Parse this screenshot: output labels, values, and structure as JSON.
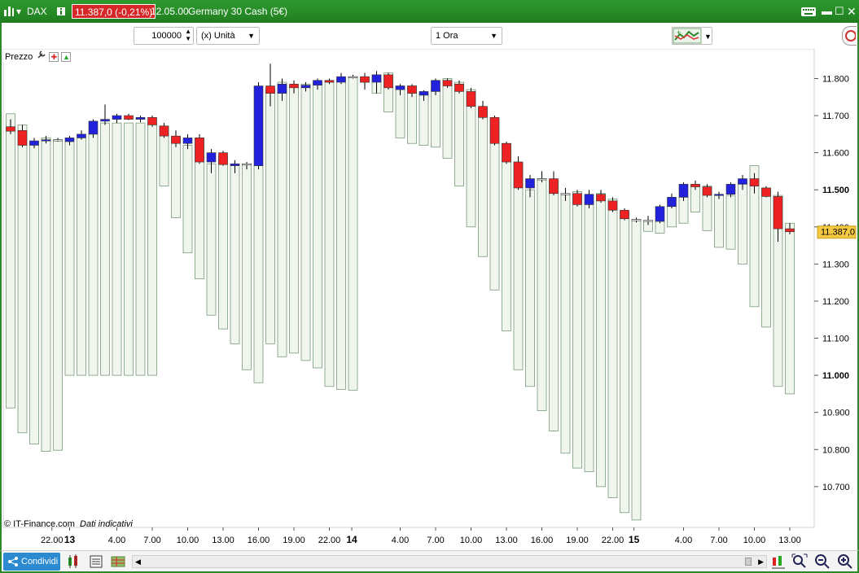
{
  "window": {
    "symbol": "DAX",
    "price_badge": "11.387,0 (-0,21%)",
    "time": "12.05.00",
    "instrument": "Germany 30 Cash (5€)"
  },
  "toolbar": {
    "quantity": "100000",
    "unit_select": "(x) Unità",
    "timeframe_select": "1 Ora"
  },
  "chart_header": {
    "label": "Prezzo"
  },
  "footer": {
    "copyright": "© IT-Finance.com",
    "disclaimer": "Dati indicativi",
    "share_label": "Condividi"
  },
  "colors": {
    "up": "#2222dd",
    "down": "#ee2222",
    "flat": "#ffffff",
    "volume_fill": "#f0f5ee",
    "volume_stroke": "#7a9a7a",
    "current_price": "#f5c842"
  },
  "chart_data": {
    "type": "candlestick",
    "y_ticks": [
      "11.800",
      "11.700",
      "11.600",
      "11.500",
      "11.400",
      "11.300",
      "11.200",
      "11.100",
      "11.000",
      "10.900",
      "10.800",
      "10.700"
    ],
    "y_tick_values": [
      11800,
      11700,
      11600,
      11500,
      11400,
      11300,
      11200,
      11100,
      11000,
      10900,
      10800,
      10700
    ],
    "y_bold_ticks": [
      "11.500",
      "11.000"
    ],
    "ylim": [
      10590,
      11880
    ],
    "current_price_label": "11.387,0",
    "current_price": 11387,
    "x_ticks": [
      {
        "label": "22.00",
        "bold": false,
        "index": 3.5
      },
      {
        "label": "13",
        "bold": true,
        "index": 5
      },
      {
        "label": "4.00",
        "bold": false,
        "index": 9
      },
      {
        "label": "7.00",
        "bold": false,
        "index": 12
      },
      {
        "label": "10.00",
        "bold": false,
        "index": 15
      },
      {
        "label": "13.00",
        "bold": false,
        "index": 18
      },
      {
        "label": "16.00",
        "bold": false,
        "index": 21
      },
      {
        "label": "19.00",
        "bold": false,
        "index": 24
      },
      {
        "label": "22.00",
        "bold": false,
        "index": 27
      },
      {
        "label": "14",
        "bold": true,
        "index": 28.9
      },
      {
        "label": "4.00",
        "bold": false,
        "index": 33
      },
      {
        "label": "7.00",
        "bold": false,
        "index": 36
      },
      {
        "label": "10.00",
        "bold": false,
        "index": 39
      },
      {
        "label": "13.00",
        "bold": false,
        "index": 42
      },
      {
        "label": "16.00",
        "bold": false,
        "index": 45
      },
      {
        "label": "19.00",
        "bold": false,
        "index": 48
      },
      {
        "label": "22.00",
        "bold": false,
        "index": 51
      },
      {
        "label": "15",
        "bold": true,
        "index": 52.8
      },
      {
        "label": "4.00",
        "bold": false,
        "index": 57
      },
      {
        "label": "7.00",
        "bold": false,
        "index": 60
      },
      {
        "label": "10.00",
        "bold": false,
        "index": 63
      },
      {
        "label": "13.00",
        "bold": false,
        "index": 66
      }
    ],
    "candles": [
      {
        "o": 11670,
        "h": 11690,
        "l": 11650,
        "c": 11658,
        "bh": 11705,
        "bl": 10912
      },
      {
        "o": 11660,
        "h": 11675,
        "l": 11615,
        "c": 11620,
        "bh": 11675,
        "bl": 10845
      },
      {
        "o": 11620,
        "h": 11640,
        "l": 11612,
        "c": 11632,
        "bh": 11630,
        "bl": 10815
      },
      {
        "o": 11632,
        "h": 11645,
        "l": 11625,
        "c": 11635,
        "bh": 11640,
        "bl": 10795
      },
      {
        "o": 11635,
        "h": 11640,
        "l": 11630,
        "c": 11635,
        "bh": 11635,
        "bl": 10798
      },
      {
        "o": 11630,
        "h": 11645,
        "l": 11620,
        "c": 11640,
        "bh": 11630,
        "bl": 11000
      },
      {
        "o": 11640,
        "h": 11660,
        "l": 11635,
        "c": 11650,
        "bh": 11640,
        "bl": 11000
      },
      {
        "o": 11650,
        "h": 11690,
        "l": 11640,
        "c": 11685,
        "bh": 11650,
        "bl": 11000
      },
      {
        "o": 11685,
        "h": 11730,
        "l": 11675,
        "c": 11690,
        "bh": 11680,
        "bl": 11000
      },
      {
        "o": 11690,
        "h": 11705,
        "l": 11680,
        "c": 11700,
        "bh": 11680,
        "bl": 11000
      },
      {
        "o": 11700,
        "h": 11705,
        "l": 11688,
        "c": 11690,
        "bh": 11680,
        "bl": 11000
      },
      {
        "o": 11690,
        "h": 11700,
        "l": 11682,
        "c": 11695,
        "bh": 11680,
        "bl": 11000
      },
      {
        "o": 11695,
        "h": 11700,
        "l": 11670,
        "c": 11675,
        "bh": 11680,
        "bl": 11000
      },
      {
        "o": 11672,
        "h": 11680,
        "l": 11640,
        "c": 11645,
        "bh": 11672,
        "bl": 11510
      },
      {
        "o": 11645,
        "h": 11660,
        "l": 11615,
        "c": 11625,
        "bh": 11640,
        "bl": 11425
      },
      {
        "o": 11625,
        "h": 11650,
        "l": 11610,
        "c": 11640,
        "bh": 11620,
        "bl": 11330
      },
      {
        "o": 11640,
        "h": 11650,
        "l": 11570,
        "c": 11575,
        "bh": 11640,
        "bl": 11260
      },
      {
        "o": 11575,
        "h": 11610,
        "l": 11545,
        "c": 11600,
        "bh": 11570,
        "bl": 11162
      },
      {
        "o": 11600,
        "h": 11605,
        "l": 11565,
        "c": 11568,
        "bh": 11590,
        "bl": 11125
      },
      {
        "o": 11565,
        "h": 11580,
        "l": 11545,
        "c": 11570,
        "bh": 11565,
        "bl": 11085
      },
      {
        "o": 11570,
        "h": 11575,
        "l": 11555,
        "c": 11570,
        "bh": 11570,
        "bl": 11015
      },
      {
        "o": 11565,
        "h": 11790,
        "l": 11555,
        "c": 11780,
        "bh": 11565,
        "bl": 10980
      },
      {
        "o": 11780,
        "h": 11840,
        "l": 11725,
        "c": 11760,
        "bh": 11770,
        "bl": 11085
      },
      {
        "o": 11760,
        "h": 11800,
        "l": 11740,
        "c": 11785,
        "bh": 11790,
        "bl": 11050
      },
      {
        "o": 11785,
        "h": 11795,
        "l": 11760,
        "c": 11775,
        "bh": 11780,
        "bl": 11060
      },
      {
        "o": 11775,
        "h": 11790,
        "l": 11765,
        "c": 11782,
        "bh": 11785,
        "bl": 11040
      },
      {
        "o": 11782,
        "h": 11800,
        "l": 11770,
        "c": 11795,
        "bh": 11790,
        "bl": 11020
      },
      {
        "o": 11795,
        "h": 11800,
        "l": 11785,
        "c": 11790,
        "bh": 11790,
        "bl": 10970
      },
      {
        "o": 11790,
        "h": 11815,
        "l": 11785,
        "c": 11805,
        "bh": 11800,
        "bl": 10962
      },
      {
        "o": 11805,
        "h": 11810,
        "l": 11800,
        "c": 11805,
        "bh": 11805,
        "bl": 10960
      },
      {
        "o": 11805,
        "h": 11815,
        "l": 11770,
        "c": 11790,
        "bh": 11800,
        "bl": 11790
      },
      {
        "o": 11790,
        "h": 11820,
        "l": 11760,
        "c": 11810,
        "bh": 11810,
        "bl": 11760
      },
      {
        "o": 11810,
        "h": 11815,
        "l": 11770,
        "c": 11775,
        "bh": 11815,
        "bl": 11710
      },
      {
        "o": 11770,
        "h": 11785,
        "l": 11755,
        "c": 11780,
        "bh": 11780,
        "bl": 11640
      },
      {
        "o": 11780,
        "h": 11785,
        "l": 11750,
        "c": 11760,
        "bh": 11780,
        "bl": 11625
      },
      {
        "o": 11755,
        "h": 11768,
        "l": 11740,
        "c": 11765,
        "bh": 11760,
        "bl": 11620
      },
      {
        "o": 11765,
        "h": 11800,
        "l": 11755,
        "c": 11795,
        "bh": 11770,
        "bl": 11615
      },
      {
        "o": 11795,
        "h": 11800,
        "l": 11775,
        "c": 11780,
        "bh": 11800,
        "bl": 11585
      },
      {
        "o": 11785,
        "h": 11795,
        "l": 11760,
        "c": 11765,
        "bh": 11790,
        "bl": 11510
      },
      {
        "o": 11765,
        "h": 11775,
        "l": 11720,
        "c": 11725,
        "bh": 11770,
        "bl": 11400
      },
      {
        "o": 11725,
        "h": 11740,
        "l": 11690,
        "c": 11695,
        "bh": 11720,
        "bl": 11320
      },
      {
        "o": 11695,
        "h": 11700,
        "l": 11620,
        "c": 11625,
        "bh": 11690,
        "bl": 11230
      },
      {
        "o": 11625,
        "h": 11630,
        "l": 11570,
        "c": 11575,
        "bh": 11625,
        "bl": 11120
      },
      {
        "o": 11575,
        "h": 11590,
        "l": 11500,
        "c": 11505,
        "bh": 11575,
        "bl": 11015
      },
      {
        "o": 11505,
        "h": 11540,
        "l": 11480,
        "c": 11530,
        "bh": 11500,
        "bl": 10970
      },
      {
        "o": 11530,
        "h": 11550,
        "l": 11520,
        "c": 11530,
        "bh": 11530,
        "bl": 10905
      },
      {
        "o": 11530,
        "h": 11550,
        "l": 11485,
        "c": 11490,
        "bh": 11525,
        "bl": 10850
      },
      {
        "o": 11490,
        "h": 11505,
        "l": 11470,
        "c": 11490,
        "bh": 11490,
        "bl": 10790
      },
      {
        "o": 11490,
        "h": 11500,
        "l": 11455,
        "c": 11460,
        "bh": 11495,
        "bl": 10750
      },
      {
        "o": 11460,
        "h": 11500,
        "l": 11450,
        "c": 11488,
        "bh": 11470,
        "bl": 10740
      },
      {
        "o": 11488,
        "h": 11500,
        "l": 11465,
        "c": 11470,
        "bh": 11490,
        "bl": 10700
      },
      {
        "o": 11470,
        "h": 11480,
        "l": 11440,
        "c": 11445,
        "bh": 11475,
        "bl": 10670
      },
      {
        "o": 11445,
        "h": 11450,
        "l": 11418,
        "c": 11422,
        "bh": 11440,
        "bl": 10630
      },
      {
        "o": 11420,
        "h": 11425,
        "l": 11412,
        "c": 11420,
        "bh": 11420,
        "bl": 10610
      },
      {
        "o": 11418,
        "h": 11430,
        "l": 11405,
        "c": 11418,
        "bh": 11415,
        "bl": 11388
      },
      {
        "o": 11415,
        "h": 11460,
        "l": 11410,
        "c": 11455,
        "bh": 11415,
        "bl": 11383
      },
      {
        "o": 11455,
        "h": 11490,
        "l": 11450,
        "c": 11480,
        "bh": 11455,
        "bl": 11400
      },
      {
        "o": 11480,
        "h": 11520,
        "l": 11470,
        "c": 11515,
        "bh": 11480,
        "bl": 11410
      },
      {
        "o": 11515,
        "h": 11525,
        "l": 11500,
        "c": 11508,
        "bh": 11515,
        "bl": 11440
      },
      {
        "o": 11508,
        "h": 11515,
        "l": 11480,
        "c": 11485,
        "bh": 11510,
        "bl": 11390
      },
      {
        "o": 11485,
        "h": 11495,
        "l": 11475,
        "c": 11488,
        "bh": 11485,
        "bl": 11345
      },
      {
        "o": 11488,
        "h": 11520,
        "l": 11480,
        "c": 11515,
        "bh": 11485,
        "bl": 11340
      },
      {
        "o": 11515,
        "h": 11540,
        "l": 11500,
        "c": 11530,
        "bh": 11520,
        "bl": 11300
      },
      {
        "o": 11530,
        "h": 11545,
        "l": 11490,
        "c": 11510,
        "bh": 11565,
        "bl": 11185
      },
      {
        "o": 11505,
        "h": 11510,
        "l": 11480,
        "c": 11482,
        "bh": 11505,
        "bl": 11130
      },
      {
        "o": 11482,
        "h": 11495,
        "l": 11360,
        "c": 11395,
        "bh": 11485,
        "bl": 10970
      },
      {
        "o": 11395,
        "h": 11410,
        "l": 11380,
        "c": 11387,
        "bh": 11410,
        "bl": 10950
      }
    ]
  }
}
